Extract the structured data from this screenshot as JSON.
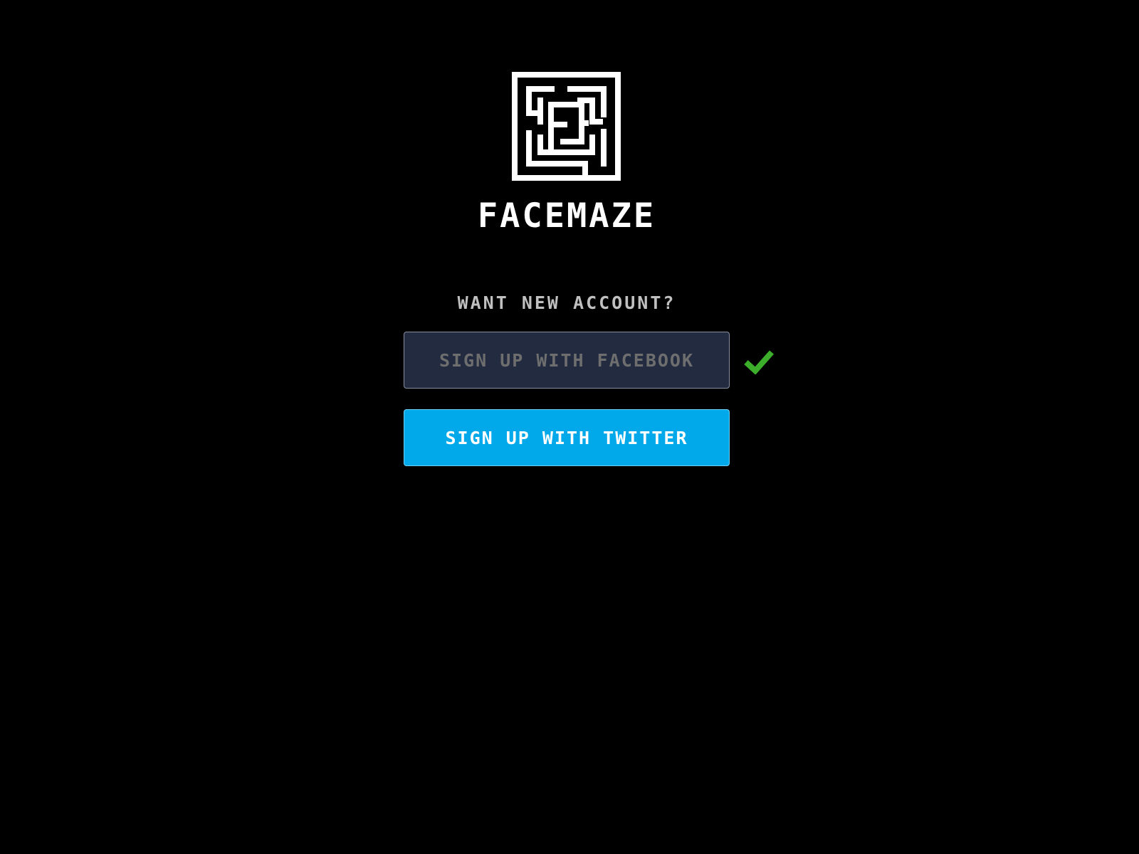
{
  "brand": {
    "logo_icon": "maze-logo-icon",
    "name": "FACEMAZE"
  },
  "signup": {
    "prompt": "WANT NEW ACCOUNT?",
    "facebook_label": "SIGN UP WITH FACEBOOK",
    "facebook_status_icon": "checkmark-icon",
    "twitter_label": "SIGN UP WITH TWITTER"
  },
  "colors": {
    "background": "#000000",
    "facebook_button_bg": "#222b40",
    "twitter_button_bg": "#02a9ea",
    "check_green": "#3dae2b",
    "prompt_text": "#c0c0c0"
  }
}
